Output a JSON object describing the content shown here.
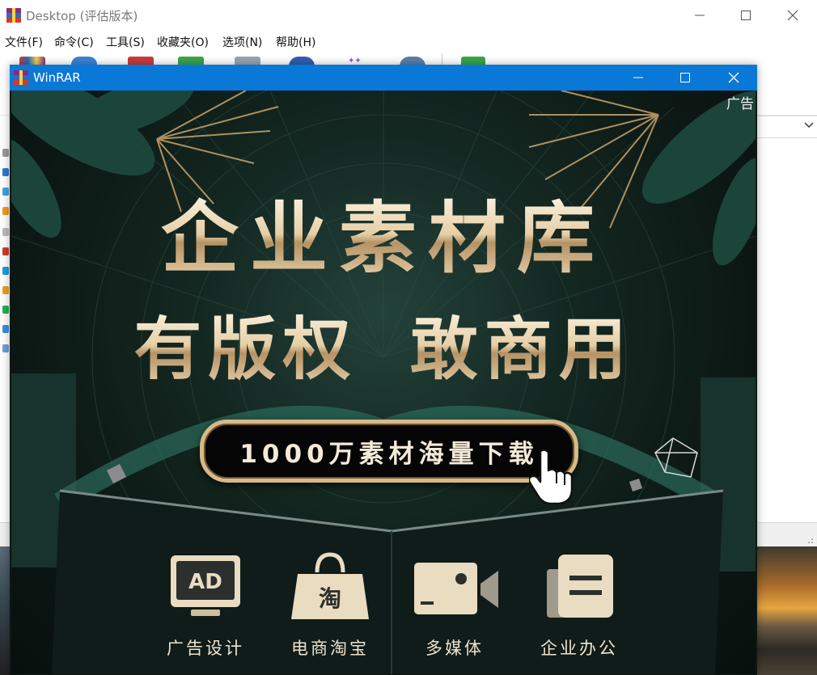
{
  "background_window": {
    "title": "Desktop (评估版本)",
    "menus": [
      "文件(F)",
      "命令(C)",
      "工具(S)",
      "收藏夹(O)",
      "选项(N)",
      "帮助(H)"
    ]
  },
  "ad_window": {
    "title": "WinRAR",
    "ad_label": "广告",
    "headline_line1": "企业素材库",
    "headline_line2": "有版权 敢商用",
    "cta": "1000万素材海量下载",
    "categories": [
      {
        "label": "广告设计",
        "icon": "ad-monitor-icon",
        "icon_text": "AD"
      },
      {
        "label": "电商淘宝",
        "icon": "shopping-bag-icon",
        "icon_text": "淘"
      },
      {
        "label": "多媒体",
        "icon": "video-camera-icon"
      },
      {
        "label": "企业办公",
        "icon": "document-icon"
      }
    ]
  },
  "colors": {
    "titlebar_blue": "#0a78d7",
    "gold_text": "#e6cfa6",
    "ad_background": "#0d1714"
  }
}
